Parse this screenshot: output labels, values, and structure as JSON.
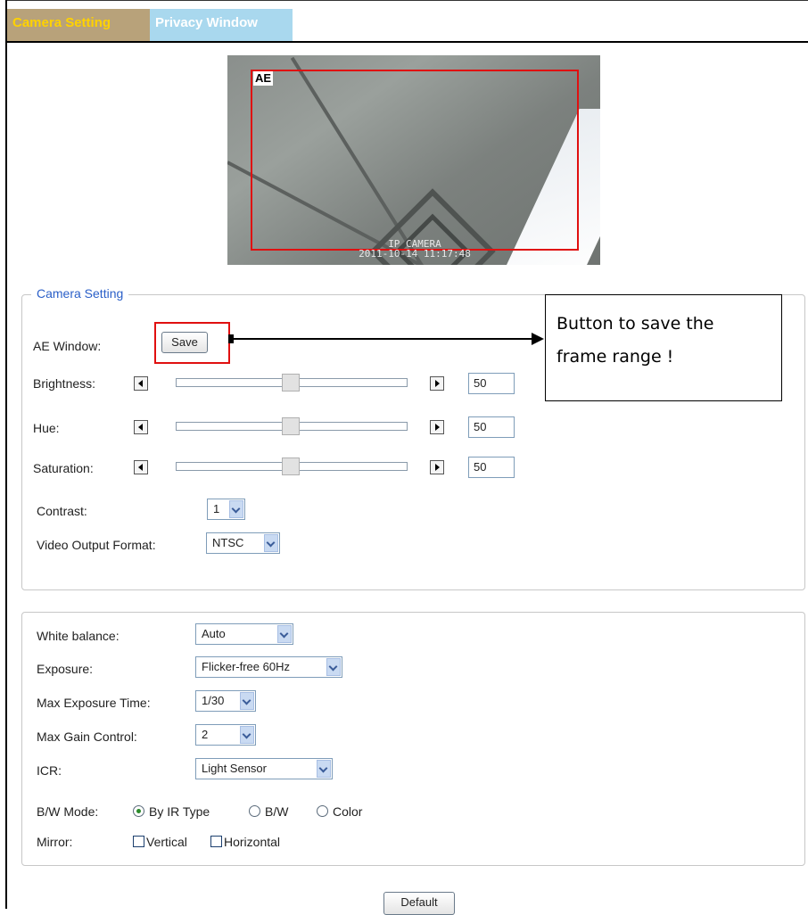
{
  "tabs": [
    {
      "label": "Camera Setting",
      "active": true
    },
    {
      "label": "Privacy Window",
      "active": false
    }
  ],
  "preview": {
    "ae_label": "AE",
    "osd_line1": "IP CAMERA",
    "osd_line2": "2011-10-14 11:17:48"
  },
  "camera_setting": {
    "legend": "Camera Setting",
    "ae_window_label": "AE Window:",
    "save_label": "Save",
    "brightness": {
      "label": "Brightness:",
      "value": "50"
    },
    "hue": {
      "label": "Hue:",
      "value": "50"
    },
    "saturation": {
      "label": "Saturation:",
      "value": "50"
    },
    "contrast": {
      "label": "Contrast:",
      "value": "1"
    },
    "video_output": {
      "label": "Video Output Format:",
      "value": "NTSC"
    }
  },
  "advanced": {
    "white_balance": {
      "label": "White balance:",
      "value": "Auto"
    },
    "exposure": {
      "label": "Exposure:",
      "value": "Flicker-free 60Hz"
    },
    "max_exposure_time": {
      "label": "Max Exposure Time:",
      "value": "1/30"
    },
    "max_gain": {
      "label": "Max Gain Control:",
      "value": "2"
    },
    "icr": {
      "label": "ICR:",
      "value": "Light Sensor"
    },
    "bw_mode": {
      "label": "B/W Mode:",
      "options": [
        "By IR Type",
        "B/W",
        "Color"
      ],
      "selected": "By IR Type"
    },
    "mirror": {
      "label": "Mirror:",
      "options": [
        "Vertical",
        "Horizontal"
      ]
    }
  },
  "default_label": "Default",
  "annotation": {
    "line1": "Button to save the",
    "line2": "frame range !"
  },
  "colors": {
    "tab_active_bg": "#b8a27a",
    "tab_active_text": "#ffd200",
    "tab_inactive_bg": "#a9d8ee",
    "highlight": "#e01010",
    "legend": "#2a5fc8"
  }
}
